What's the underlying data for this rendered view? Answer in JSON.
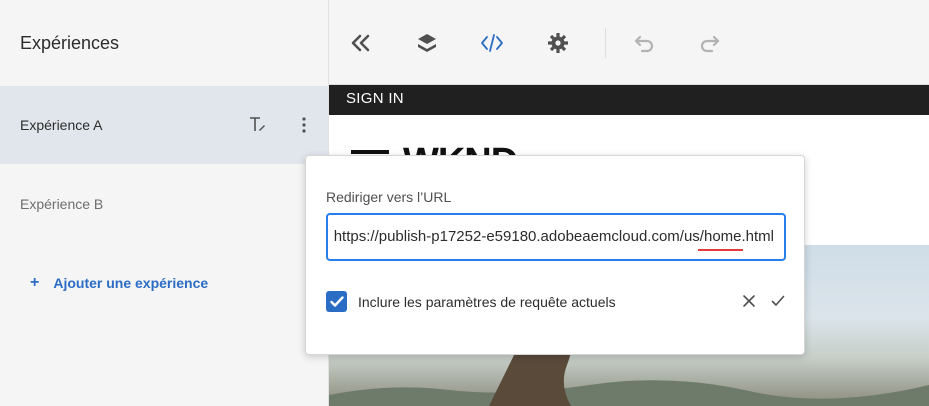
{
  "sidebar": {
    "title": "Expériences",
    "experiences": [
      {
        "label": "Expérience A"
      },
      {
        "label": "Expérience B"
      }
    ],
    "add_label": "Ajouter une expérience",
    "add_symbol": "+"
  },
  "toolbar": {
    "icons": [
      "collapse-icon",
      "layers-icon",
      "code-icon",
      "settings-icon",
      "undo-icon",
      "redo-icon"
    ]
  },
  "preview": {
    "signin": "SIGN IN",
    "logo": "WKND"
  },
  "redirect_popover": {
    "label": "Rediriger vers l’URL",
    "url_value": "https://publish-p17252-e59180.adobeaemcloud.com/us/home.html",
    "checkbox_label": "Inclure les paramètres de requête actuels",
    "checkbox_checked": true
  },
  "colors": {
    "accent": "#2b6cc4",
    "focus": "#2680eb",
    "selected_bg": "#e1e6ed",
    "panel_bg": "#f5f5f5"
  }
}
